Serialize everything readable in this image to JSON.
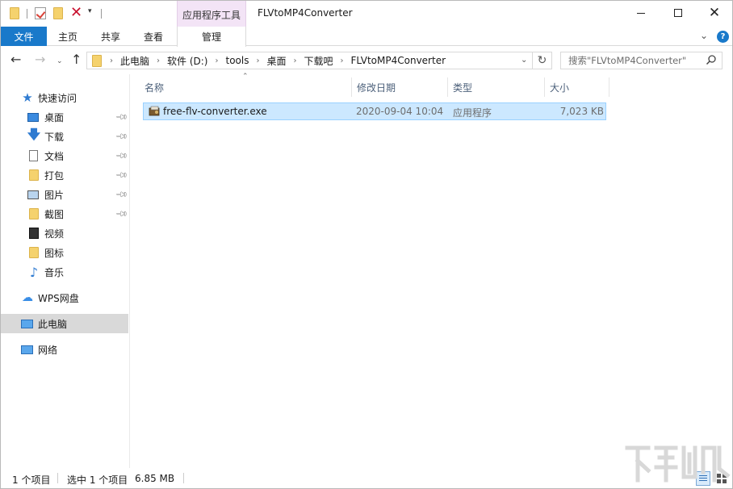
{
  "title_bar": {
    "window_title": "FLVtoMP4Converter",
    "contextual_tab_group": "应用程序工具",
    "quick_access_icons": [
      "folder-icon",
      "properties-check-icon",
      "new-folder-icon",
      "delete-x-icon",
      "customize-dropdown-icon"
    ],
    "controls": [
      "minimize-icon",
      "maximize-icon",
      "close-icon"
    ]
  },
  "ribbon": {
    "file_tab": "文件",
    "tabs": [
      "主页",
      "共享",
      "查看"
    ],
    "contextual_tab": "管理",
    "help_label": "?"
  },
  "address_bar": {
    "breadcrumbs": [
      "此电脑",
      "软件 (D:)",
      "tools",
      "桌面",
      "下载吧",
      "FLVtoMP4Converter"
    ],
    "search_placeholder": "搜索\"FLVtoMP4Converter\""
  },
  "sidebar": {
    "quick_access": {
      "label": "快速访问",
      "items": [
        {
          "label": "桌面",
          "icon": "desktop-icon",
          "pinned": true
        },
        {
          "label": "下载",
          "icon": "download-icon",
          "pinned": true
        },
        {
          "label": "文档",
          "icon": "document-icon",
          "pinned": true
        },
        {
          "label": "打包",
          "icon": "folder-icon",
          "pinned": true
        },
        {
          "label": "图片",
          "icon": "pictures-icon",
          "pinned": true
        },
        {
          "label": "截图",
          "icon": "folder-icon",
          "pinned": true
        },
        {
          "label": "视频",
          "icon": "video-icon",
          "pinned": false
        },
        {
          "label": "图标",
          "icon": "folder-icon",
          "pinned": false
        },
        {
          "label": "音乐",
          "icon": "music-icon",
          "pinned": false
        }
      ]
    },
    "wps": "WPS网盘",
    "this_pc": "此电脑",
    "network": "网络",
    "selected": "此电脑"
  },
  "file_list": {
    "columns": [
      "名称",
      "修改日期",
      "类型",
      "大小"
    ],
    "sort_column": "名称",
    "rows": [
      {
        "name": "free-flv-converter.exe",
        "modified": "2020-09-04 10:04",
        "type": "应用程序",
        "size": "7,023 KB",
        "selected": true
      }
    ]
  },
  "status_bar": {
    "item_count": "1 个项目",
    "selected_count": "选中 1 个项目",
    "selected_size": "6.85 MB",
    "view_mode": "details"
  },
  "colors": {
    "file_tab": "#1979ca",
    "contextual_tab": "#f3e4f6",
    "selection_fill": "#cce8ff",
    "selection_border": "#99d1ff",
    "sidebar_selected": "#d9d9d9"
  }
}
